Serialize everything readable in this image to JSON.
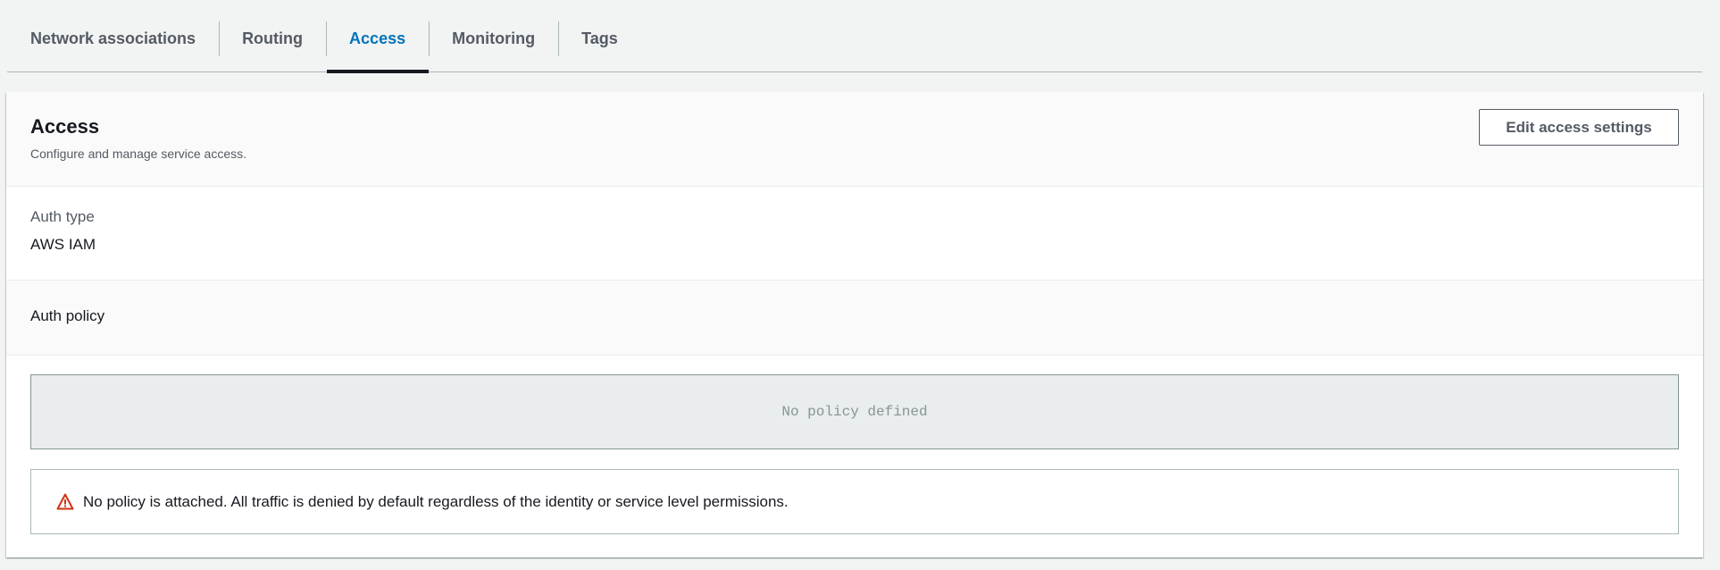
{
  "tabs": [
    {
      "label": "Network associations"
    },
    {
      "label": "Routing"
    },
    {
      "label": "Access",
      "active": true
    },
    {
      "label": "Monitoring"
    },
    {
      "label": "Tags"
    }
  ],
  "access": {
    "title": "Access",
    "description": "Configure and manage service access.",
    "edit_button": "Edit access settings",
    "auth_type_label": "Auth type",
    "auth_type_value": "AWS IAM",
    "auth_policy_label": "Auth policy",
    "policy_placeholder": "No policy defined",
    "warning": "No policy is attached. All traffic is denied by default regardless of the identity or service level permissions.",
    "warning_icon": "warning-triangle-icon",
    "warning_color": "#d13212"
  }
}
